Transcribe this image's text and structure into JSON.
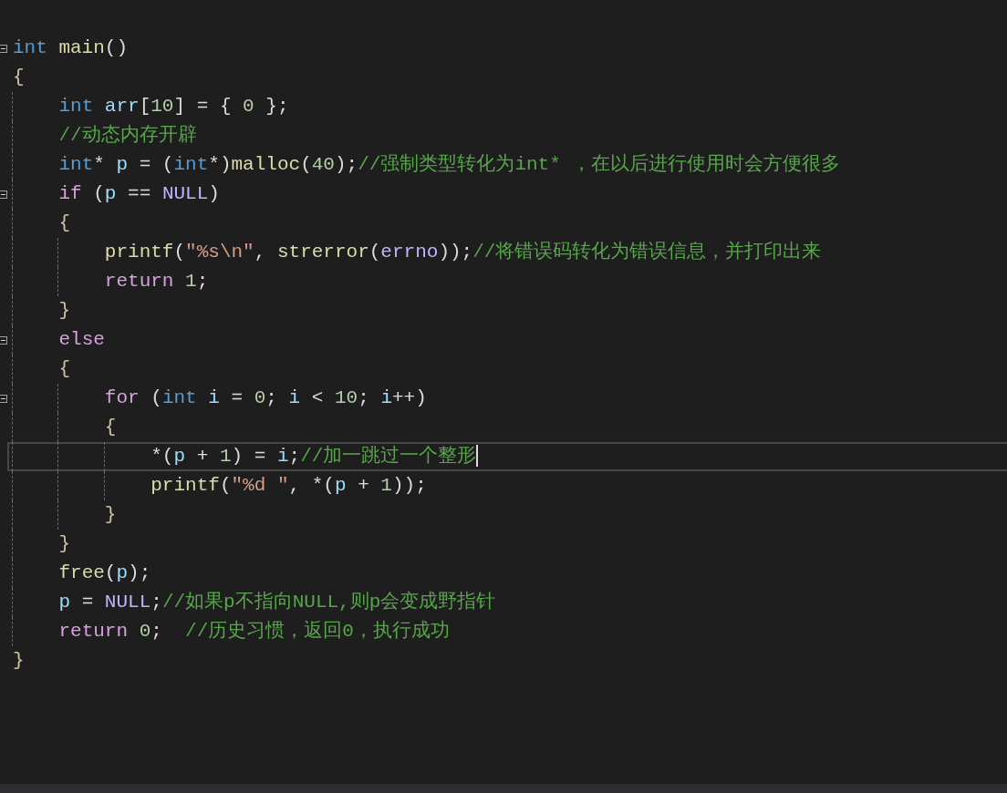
{
  "editor": {
    "lines": [
      {
        "fold": true,
        "current": false,
        "tokens": [
          {
            "kind": "keyword",
            "text": "int"
          },
          {
            "kind": "function",
            "text": " main"
          },
          {
            "kind": "plain",
            "text": "()"
          }
        ]
      },
      {
        "fold": false,
        "current": false,
        "tokens": [
          {
            "kind": "brace",
            "text": "{"
          }
        ]
      },
      {
        "fold": false,
        "current": false,
        "tokens": [
          {
            "kind": "keyword",
            "text": "    int"
          },
          {
            "kind": "variable",
            "text": " arr"
          },
          {
            "kind": "plain",
            "text": "["
          },
          {
            "kind": "number",
            "text": "10"
          },
          {
            "kind": "plain",
            "text": "] = { "
          },
          {
            "kind": "number",
            "text": "0"
          },
          {
            "kind": "plain",
            "text": " };"
          }
        ]
      },
      {
        "fold": false,
        "current": false,
        "tokens": [
          {
            "kind": "comment",
            "text": "    //动态内存开辟"
          }
        ]
      },
      {
        "fold": false,
        "current": false,
        "tokens": [
          {
            "kind": "keyword",
            "text": "    int"
          },
          {
            "kind": "plain",
            "text": "* "
          },
          {
            "kind": "variable",
            "text": "p"
          },
          {
            "kind": "plain",
            "text": " = ("
          },
          {
            "kind": "keyword",
            "text": "int"
          },
          {
            "kind": "plain",
            "text": "*)"
          },
          {
            "kind": "function",
            "text": "malloc"
          },
          {
            "kind": "plain",
            "text": "("
          },
          {
            "kind": "number",
            "text": "40"
          },
          {
            "kind": "plain",
            "text": ");"
          },
          {
            "kind": "comment",
            "text": "//强制类型转化为int* ，在以后进行使用时会方便很多"
          }
        ]
      },
      {
        "fold": true,
        "current": false,
        "tokens": [
          {
            "kind": "control",
            "text": "    if"
          },
          {
            "kind": "plain",
            "text": " ("
          },
          {
            "kind": "variable",
            "text": "p"
          },
          {
            "kind": "plain",
            "text": " == "
          },
          {
            "kind": "macro",
            "text": "NULL"
          },
          {
            "kind": "plain",
            "text": ")"
          }
        ]
      },
      {
        "fold": false,
        "current": false,
        "tokens": [
          {
            "kind": "brace",
            "text": "    {"
          }
        ]
      },
      {
        "fold": false,
        "current": false,
        "tokens": [
          {
            "kind": "function",
            "text": "        printf"
          },
          {
            "kind": "plain",
            "text": "("
          },
          {
            "kind": "string",
            "text": "\"%s\\n\""
          },
          {
            "kind": "plain",
            "text": ", "
          },
          {
            "kind": "function",
            "text": "strerror"
          },
          {
            "kind": "plain",
            "text": "("
          },
          {
            "kind": "macro",
            "text": "errno"
          },
          {
            "kind": "plain",
            "text": "));"
          },
          {
            "kind": "comment",
            "text": "//将错误码转化为错误信息，并打印出来"
          }
        ]
      },
      {
        "fold": false,
        "current": false,
        "tokens": [
          {
            "kind": "control",
            "text": "        return"
          },
          {
            "kind": "number",
            "text": " 1"
          },
          {
            "kind": "plain",
            "text": ";"
          }
        ]
      },
      {
        "fold": false,
        "current": false,
        "tokens": [
          {
            "kind": "brace",
            "text": "    }"
          }
        ]
      },
      {
        "fold": true,
        "current": false,
        "tokens": [
          {
            "kind": "control",
            "text": "    else"
          }
        ]
      },
      {
        "fold": false,
        "current": false,
        "tokens": [
          {
            "kind": "brace",
            "text": "    {"
          }
        ]
      },
      {
        "fold": true,
        "current": false,
        "tokens": [
          {
            "kind": "control",
            "text": "        for"
          },
          {
            "kind": "plain",
            "text": " ("
          },
          {
            "kind": "keyword",
            "text": "int"
          },
          {
            "kind": "variable",
            "text": " i"
          },
          {
            "kind": "plain",
            "text": " = "
          },
          {
            "kind": "number",
            "text": "0"
          },
          {
            "kind": "plain",
            "text": "; "
          },
          {
            "kind": "variable",
            "text": "i"
          },
          {
            "kind": "plain",
            "text": " < "
          },
          {
            "kind": "number",
            "text": "10"
          },
          {
            "kind": "plain",
            "text": "; "
          },
          {
            "kind": "variable",
            "text": "i"
          },
          {
            "kind": "plain",
            "text": "++)"
          }
        ]
      },
      {
        "fold": false,
        "current": false,
        "tokens": [
          {
            "kind": "brace",
            "text": "        {"
          }
        ]
      },
      {
        "fold": false,
        "current": true,
        "tokens": [
          {
            "kind": "plain",
            "text": "            *("
          },
          {
            "kind": "variable",
            "text": "p"
          },
          {
            "kind": "plain",
            "text": " + "
          },
          {
            "kind": "number",
            "text": "1"
          },
          {
            "kind": "plain",
            "text": ") = "
          },
          {
            "kind": "variable",
            "text": "i"
          },
          {
            "kind": "plain",
            "text": ";"
          },
          {
            "kind": "comment",
            "text": "//加一跳过一个整形"
          }
        ]
      },
      {
        "fold": false,
        "current": false,
        "tokens": [
          {
            "kind": "function",
            "text": "            printf"
          },
          {
            "kind": "plain",
            "text": "("
          },
          {
            "kind": "string",
            "text": "\"%d \""
          },
          {
            "kind": "plain",
            "text": ", *("
          },
          {
            "kind": "variable",
            "text": "p"
          },
          {
            "kind": "plain",
            "text": " + "
          },
          {
            "kind": "number",
            "text": "1"
          },
          {
            "kind": "plain",
            "text": "));"
          }
        ]
      },
      {
        "fold": false,
        "current": false,
        "tokens": [
          {
            "kind": "brace",
            "text": "        }"
          }
        ]
      },
      {
        "fold": false,
        "current": false,
        "tokens": [
          {
            "kind": "brace",
            "text": "    }"
          }
        ]
      },
      {
        "fold": false,
        "current": false,
        "tokens": [
          {
            "kind": "function",
            "text": "    free"
          },
          {
            "kind": "plain",
            "text": "("
          },
          {
            "kind": "variable",
            "text": "p"
          },
          {
            "kind": "plain",
            "text": ");"
          }
        ]
      },
      {
        "fold": false,
        "current": false,
        "tokens": [
          {
            "kind": "variable",
            "text": "    p"
          },
          {
            "kind": "plain",
            "text": " = "
          },
          {
            "kind": "macro",
            "text": "NULL"
          },
          {
            "kind": "plain",
            "text": ";"
          },
          {
            "kind": "comment",
            "text": "//如果p不指向NULL,则p会变成野指针"
          }
        ]
      },
      {
        "fold": false,
        "current": false,
        "tokens": [
          {
            "kind": "control",
            "text": "    return"
          },
          {
            "kind": "number",
            "text": " 0"
          },
          {
            "kind": "plain",
            "text": ";  "
          },
          {
            "kind": "comment",
            "text": "//历史习惯，返回0，执行成功"
          }
        ]
      },
      {
        "fold": false,
        "current": false,
        "tokens": [
          {
            "kind": "brace",
            "text": "}"
          }
        ]
      }
    ]
  }
}
